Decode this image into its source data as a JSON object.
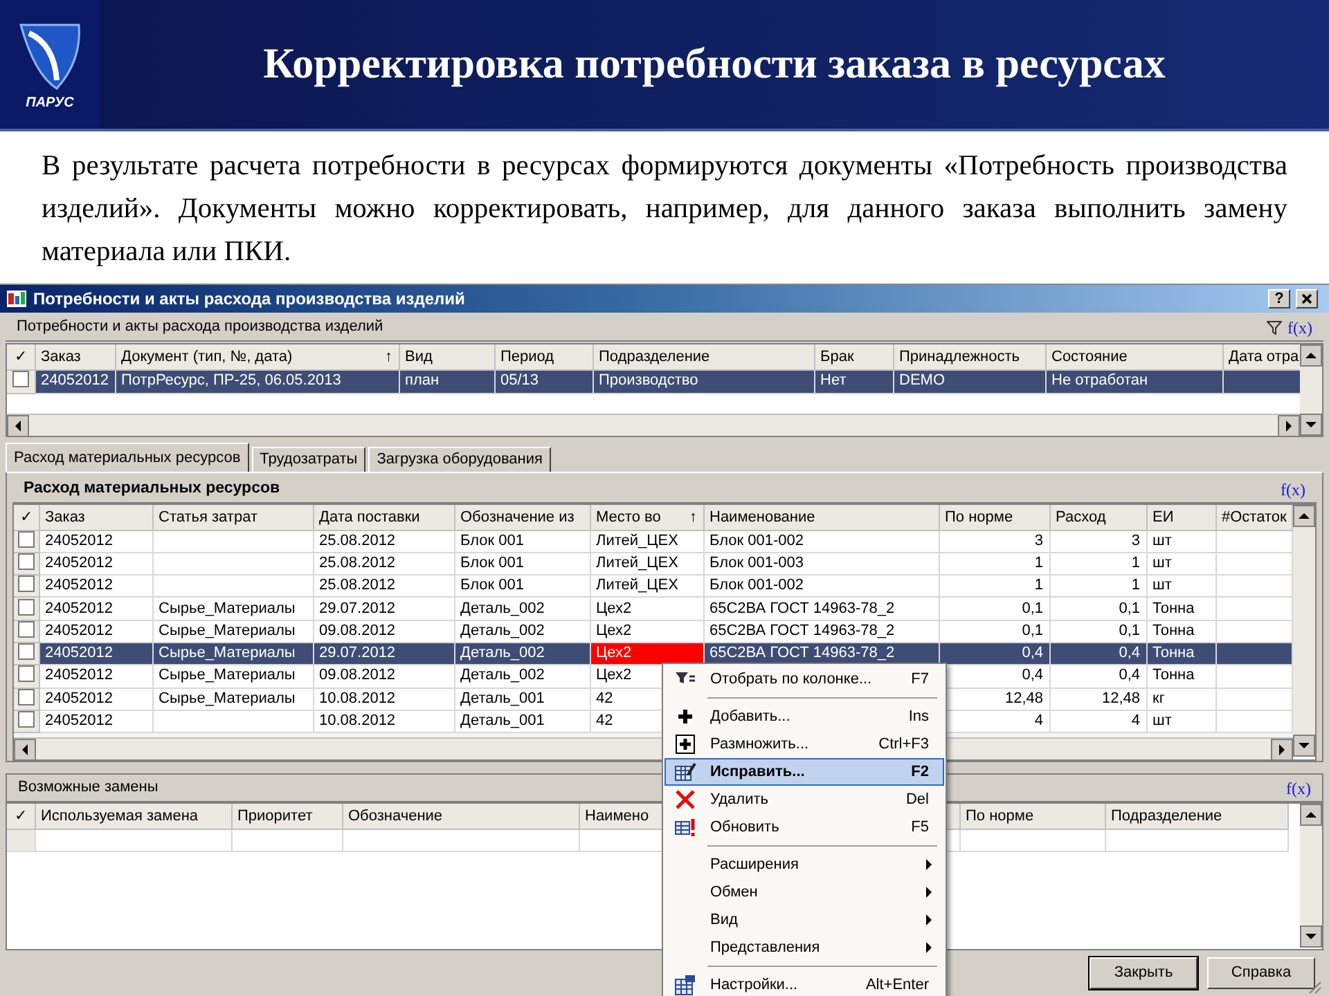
{
  "slide": {
    "logo_text": "ПАРУС",
    "title": "Корректировка потребности заказа в ресурсах",
    "text": "В результате расчета потребности в ресурсах формируются документы «Потребность производства изделий». Документы можно корректировать, например, для данного заказа выполнить замену материала или ПКИ."
  },
  "window": {
    "title": "Потребности и акты расхода производства изделий",
    "help": "?"
  },
  "documents": {
    "caption": "Потребности и акты расхода производства изделий",
    "fx": "f(x)",
    "check_header": "✓",
    "columns": [
      {
        "label": "Заказ"
      },
      {
        "label": "Документ (тип, №,  дата)",
        "sort_mark": "↑"
      },
      {
        "label": "Вид"
      },
      {
        "label": "Период"
      },
      {
        "label": "Подразделение"
      },
      {
        "label": "Брак"
      },
      {
        "label": "Принадлежность"
      },
      {
        "label": "Состояние"
      },
      {
        "label": "Дата отра"
      }
    ],
    "rows": [
      {
        "checked": false,
        "selected": true,
        "cells": [
          "24052012",
          "ПотрРесурс, ПР-25, 06.05.2013",
          "план",
          "05/13",
          "Производство",
          "Нет",
          "DEMO",
          "Не отработан",
          null
        ]
      }
    ]
  },
  "tabs": [
    {
      "label": "Расход материальных ресурсов",
      "selected": true
    },
    {
      "label": "Трудозатраты",
      "selected": false
    },
    {
      "label": "Загрузка оборудования",
      "selected": false
    }
  ],
  "materials": {
    "caption": "Расход материальных ресурсов",
    "fx": "f(x)",
    "check_header": "✓",
    "columns": [
      {
        "label": "Заказ"
      },
      {
        "label": "Статья затрат"
      },
      {
        "label": "Дата поставки"
      },
      {
        "label": "Обозначение из"
      },
      {
        "label": "Место во",
        "sort_mark": "↑"
      },
      {
        "label": "Наименование"
      },
      {
        "label": "По норме",
        "kind": "number"
      },
      {
        "label": "Расход",
        "kind": "number"
      },
      {
        "label": "ЕИ"
      },
      {
        "label": "#Остаток"
      }
    ],
    "rows": [
      {
        "checked": false,
        "selected": false,
        "place_flagged": false,
        "cells": [
          "24052012",
          null,
          "25.08.2012",
          "Блок 001",
          "Литей_ЦЕХ",
          "Блок 001-002",
          "3",
          "3",
          "шт",
          null
        ]
      },
      {
        "checked": false,
        "selected": false,
        "place_flagged": false,
        "cells": [
          "24052012",
          null,
          "25.08.2012",
          "Блок 001",
          "Литей_ЦЕХ",
          "Блок 001-003",
          "1",
          "1",
          "шт",
          null
        ]
      },
      {
        "checked": false,
        "selected": false,
        "place_flagged": false,
        "cells": [
          "24052012",
          null,
          "25.08.2012",
          "Блок 001",
          "Литей_ЦЕХ",
          "Блок 001-002",
          "1",
          "1",
          "шт",
          null
        ]
      },
      {
        "checked": false,
        "selected": false,
        "place_flagged": false,
        "cells": [
          "24052012",
          "Сырье_Материалы",
          "29.07.2012",
          "Деталь_002",
          "Цех2",
          "65С2ВА ГОСТ 14963-78_2",
          "0,1",
          "0,1",
          "Тонна",
          null
        ]
      },
      {
        "checked": false,
        "selected": false,
        "place_flagged": false,
        "cells": [
          "24052012",
          "Сырье_Материалы",
          "09.08.2012",
          "Деталь_002",
          "Цех2",
          "65С2ВА ГОСТ 14963-78_2",
          "0,1",
          "0,1",
          "Тонна",
          null
        ]
      },
      {
        "checked": false,
        "selected": true,
        "place_flagged": true,
        "cells": [
          "24052012",
          "Сырье_Материалы",
          "29.07.2012",
          "Деталь_002",
          "Цех2",
          "65С2ВА ГОСТ 14963-78_2",
          "0,4",
          "0,4",
          "Тонна",
          null
        ]
      },
      {
        "checked": false,
        "selected": false,
        "place_flagged": false,
        "cells": [
          "24052012",
          "Сырье_Материалы",
          "09.08.2012",
          "Деталь_002",
          "Цех2",
          null,
          "0,4",
          "0,4",
          "Тонна",
          null
        ]
      },
      {
        "checked": false,
        "selected": false,
        "place_flagged": false,
        "cells": [
          "24052012",
          "Сырье_Материалы",
          "10.08.2012",
          "Деталь_001",
          "42",
          null,
          "12,48",
          "12,48",
          "кг",
          null
        ]
      },
      {
        "checked": false,
        "selected": false,
        "place_flagged": false,
        "cells": [
          "24052012",
          null,
          "10.08.2012",
          "Деталь_001",
          "42",
          null,
          "4",
          "4",
          "шт",
          null
        ]
      }
    ]
  },
  "replacements": {
    "caption": "Возможные замены",
    "fx": "f(x)",
    "check_header": "✓",
    "columns": [
      {
        "label": "Используемая замена"
      },
      {
        "label": "Приоритет"
      },
      {
        "label": "Обозначение"
      },
      {
        "label": "Наимено"
      },
      {},
      {
        "label": "По норме"
      },
      {
        "label": "Подразделение"
      }
    ]
  },
  "context_menu": [
    {
      "kind": "filter",
      "label": "Отобрать по колонке...",
      "shortcut": "F7",
      "selected": false
    },
    {
      "kind": "separator"
    },
    {
      "kind": "add",
      "label": "Добавить...",
      "shortcut": "Ins",
      "selected": false
    },
    {
      "kind": "duplicate",
      "label": "Размножить...",
      "shortcut": "Ctrl+F3",
      "selected": false
    },
    {
      "kind": "edit",
      "label": "Исправить...",
      "shortcut": "F2",
      "selected": true
    },
    {
      "kind": "delete",
      "label": "Удалить",
      "shortcut": "Del",
      "selected": false
    },
    {
      "kind": "refresh",
      "label": "Обновить",
      "shortcut": "F5",
      "selected": false
    },
    {
      "kind": "separator"
    },
    {
      "kind": "submenu",
      "label": "Расширения",
      "selected": false
    },
    {
      "kind": "submenu",
      "label": "Обмен",
      "selected": false
    },
    {
      "kind": "submenu",
      "label": "Вид",
      "selected": false
    },
    {
      "kind": "submenu",
      "label": "Представления",
      "selected": false
    },
    {
      "kind": "separator"
    },
    {
      "kind": "settings",
      "label": "Настройки...",
      "shortcut": "Alt+Enter",
      "selected": false
    }
  ],
  "buttons": [
    {
      "label": "Закрыть",
      "default": true
    },
    {
      "label": "Справка",
      "default": false
    }
  ]
}
